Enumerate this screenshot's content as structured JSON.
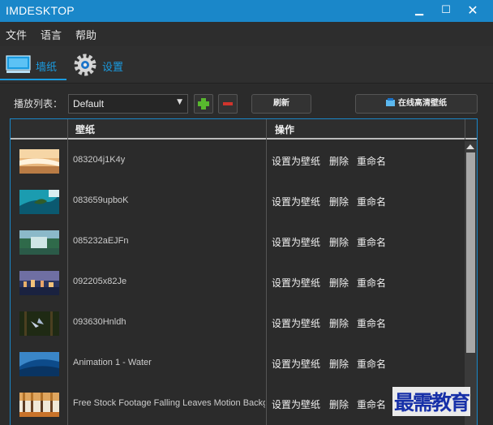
{
  "window": {
    "title": "IMDESKTOP",
    "min": "▁",
    "max": "☐",
    "close": "✕"
  },
  "menu": [
    "文件",
    "语言",
    "帮助"
  ],
  "tabs": [
    {
      "label": "墙纸",
      "icon": "monitor-icon",
      "active": true
    },
    {
      "label": "设置",
      "icon": "gear-icon",
      "active": false
    }
  ],
  "toolbar": {
    "playlist_label": "播放列表：",
    "playlist_value": "Default",
    "refresh_label": "刷新",
    "online_label": "在线高清壁纸"
  },
  "table": {
    "headers": [
      "壁纸",
      "操作"
    ],
    "actions": [
      "设置为壁纸",
      "删除",
      "重命名"
    ],
    "rows": [
      {
        "name": "083204j1K4y",
        "thumb": "beach"
      },
      {
        "name": "083659upboK",
        "thumb": "aerial-coast"
      },
      {
        "name": "085232aEJFn",
        "thumb": "waterfall"
      },
      {
        "name": "092205x82Je",
        "thumb": "city-night"
      },
      {
        "name": "093630Hnldh",
        "thumb": "forest"
      },
      {
        "name": "Animation 1 - Water",
        "thumb": "water"
      },
      {
        "name": "Free Stock Footage Falling Leaves Motion Background",
        "thumb": "autumn-leaves"
      }
    ]
  },
  "colors": {
    "accent": "#1a9be0",
    "titlebar": "#1a87c9",
    "add": "#58b82e",
    "remove": "#d0342c"
  },
  "watermark": "最需教育"
}
